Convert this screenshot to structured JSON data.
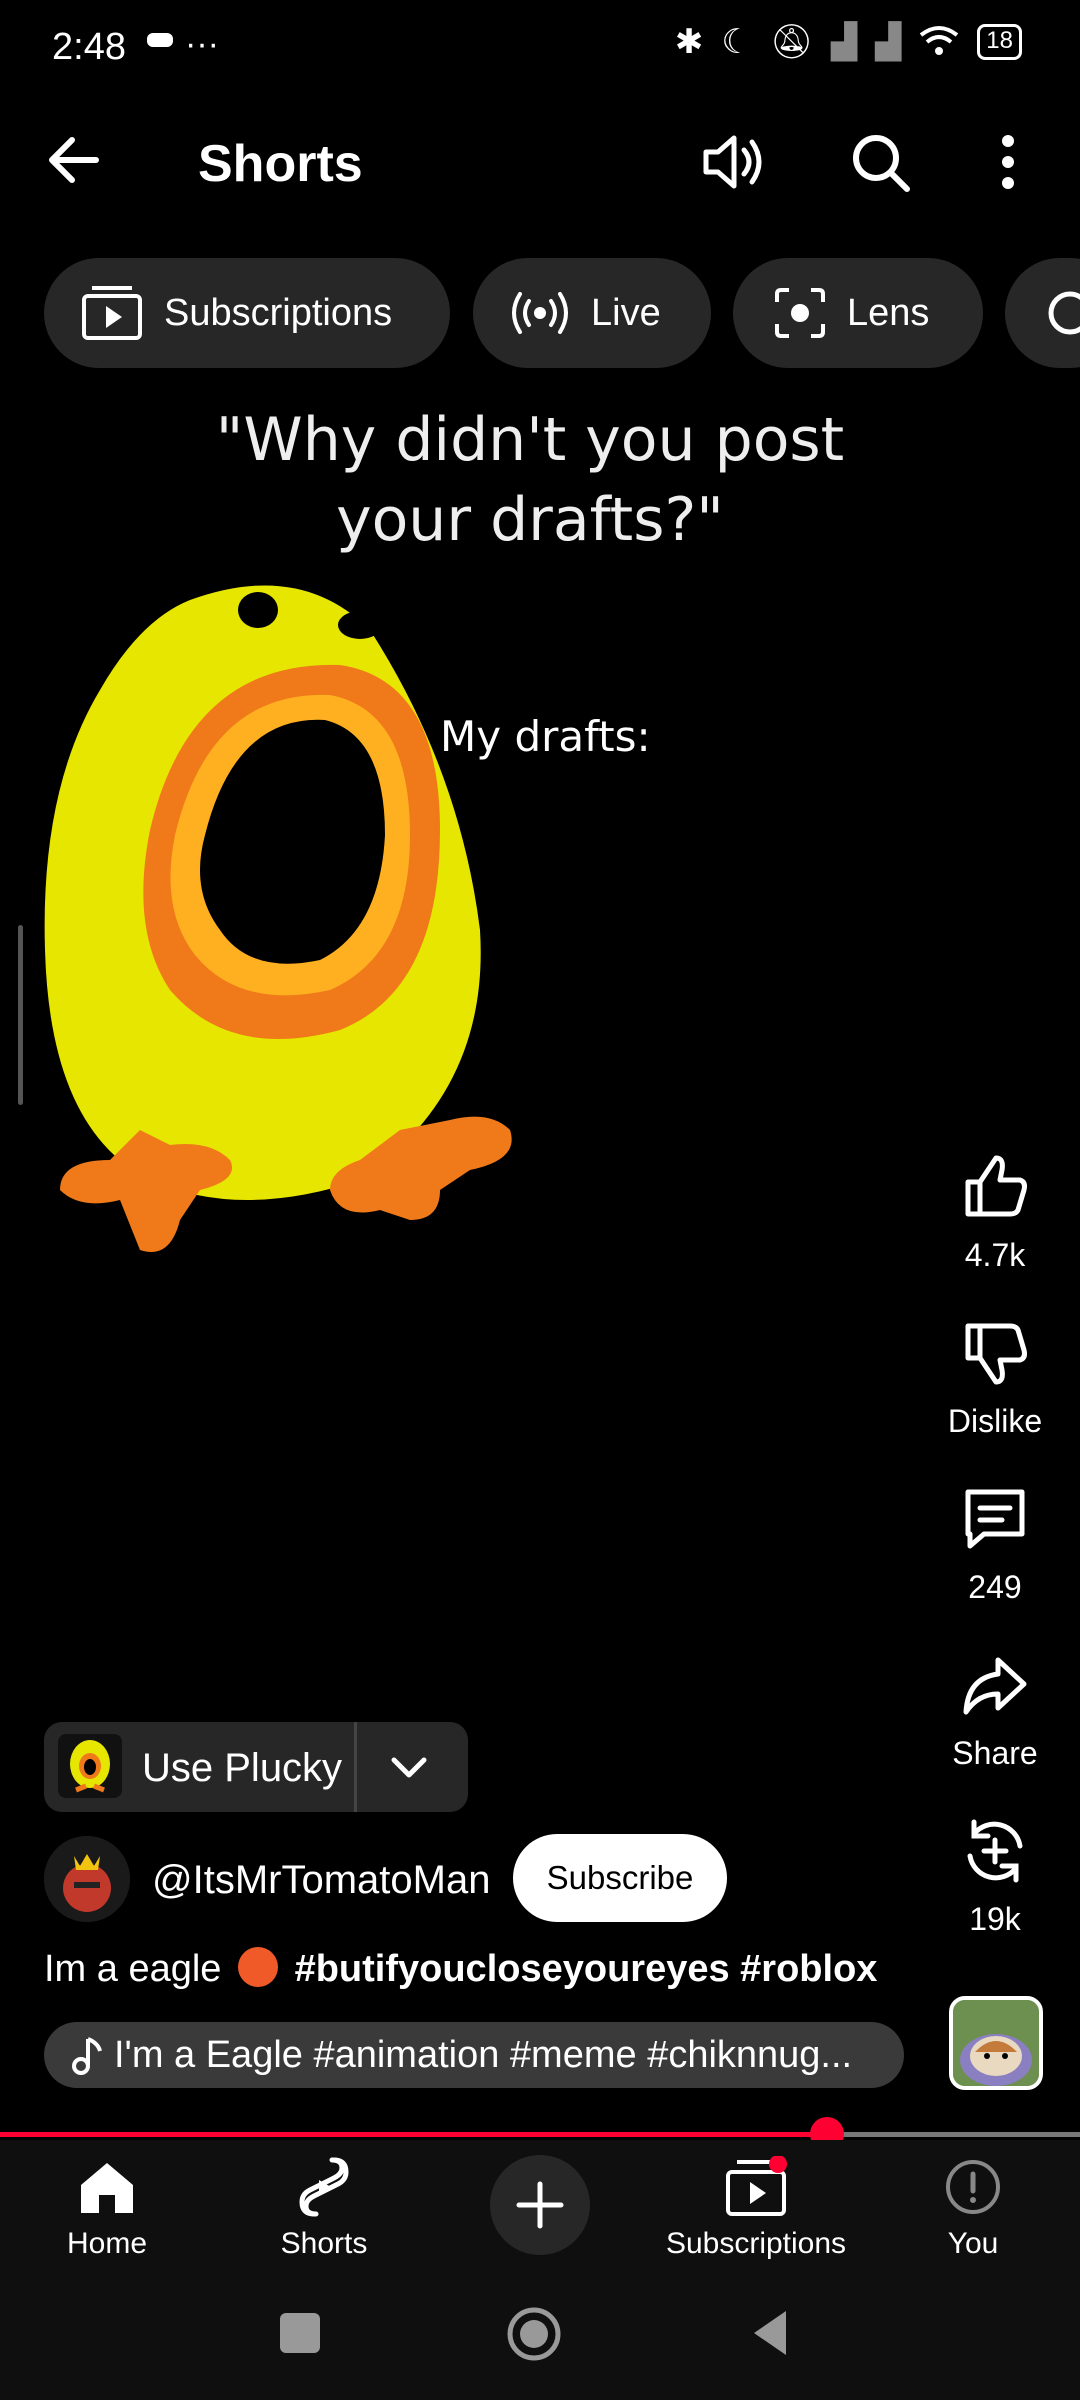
{
  "status_bar": {
    "time": "2:48",
    "misc": "···",
    "battery": "18"
  },
  "header": {
    "title": "Shorts"
  },
  "chips": [
    {
      "label": "Subscriptions"
    },
    {
      "label": "Live"
    },
    {
      "label": "Lens"
    }
  ],
  "video": {
    "caption_top_line1": "\"Why didn't you post",
    "caption_top_line2": "your drafts?\"",
    "caption_drafts": "My drafts:"
  },
  "actions": {
    "likes": "4.7k",
    "dislike": "Dislike",
    "comments": "249",
    "share": "Share",
    "remix": "19k"
  },
  "effect": {
    "label": "Use Plucky"
  },
  "channel": {
    "handle": "@ItsMrTomatoMan",
    "subscribe": "Subscribe"
  },
  "description": {
    "text": "Im a eagle",
    "tags": "#butifyoucloseyoureyes #roblox"
  },
  "music": {
    "text": "I'm a Eagle #animation #meme #chiknnug..."
  },
  "progress": {
    "fraction": 0.766
  },
  "nav": {
    "home": "Home",
    "shorts": "Shorts",
    "subscriptions": "Subscriptions",
    "you": "You"
  },
  "colors": {
    "accent": "#ff0033",
    "chip_bg": "#272727",
    "chick_yellow": "#e6e600",
    "chick_orange": "#f07a1a"
  }
}
